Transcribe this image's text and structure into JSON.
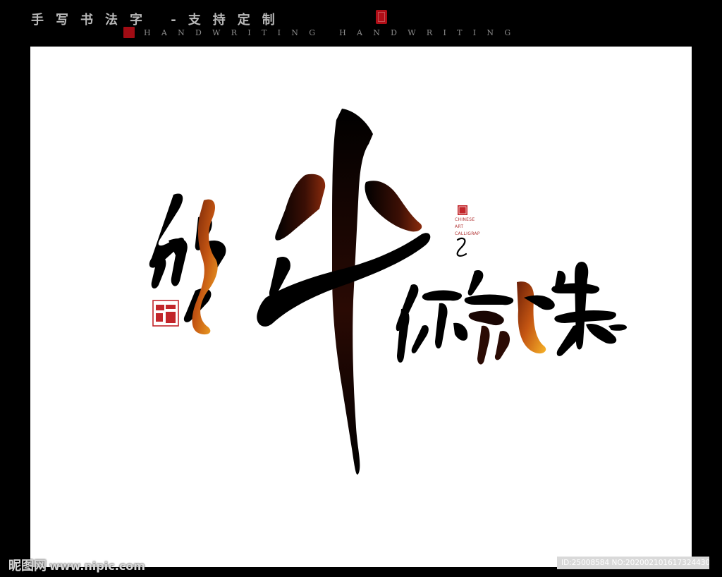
{
  "header": {
    "title": "手写书法字 -支持定制",
    "subtitle": "HANDWRITING HANDWRITING"
  },
  "artwork": {
    "main_text": "够牛你就来",
    "side_note": {
      "line1": "CHINESE",
      "line2": "ART",
      "line3": "CALLIGRAP"
    },
    "gradient_colors": [
      "#000000",
      "#3a0e05",
      "#8a2b0c",
      "#e07a16",
      "#f6b328"
    ],
    "seal_color": "#c2252a"
  },
  "watermark": {
    "site": "昵图网",
    "url": "www.nipic.com",
    "id_text": "ID:25008584 NO:20200210161732443086"
  }
}
